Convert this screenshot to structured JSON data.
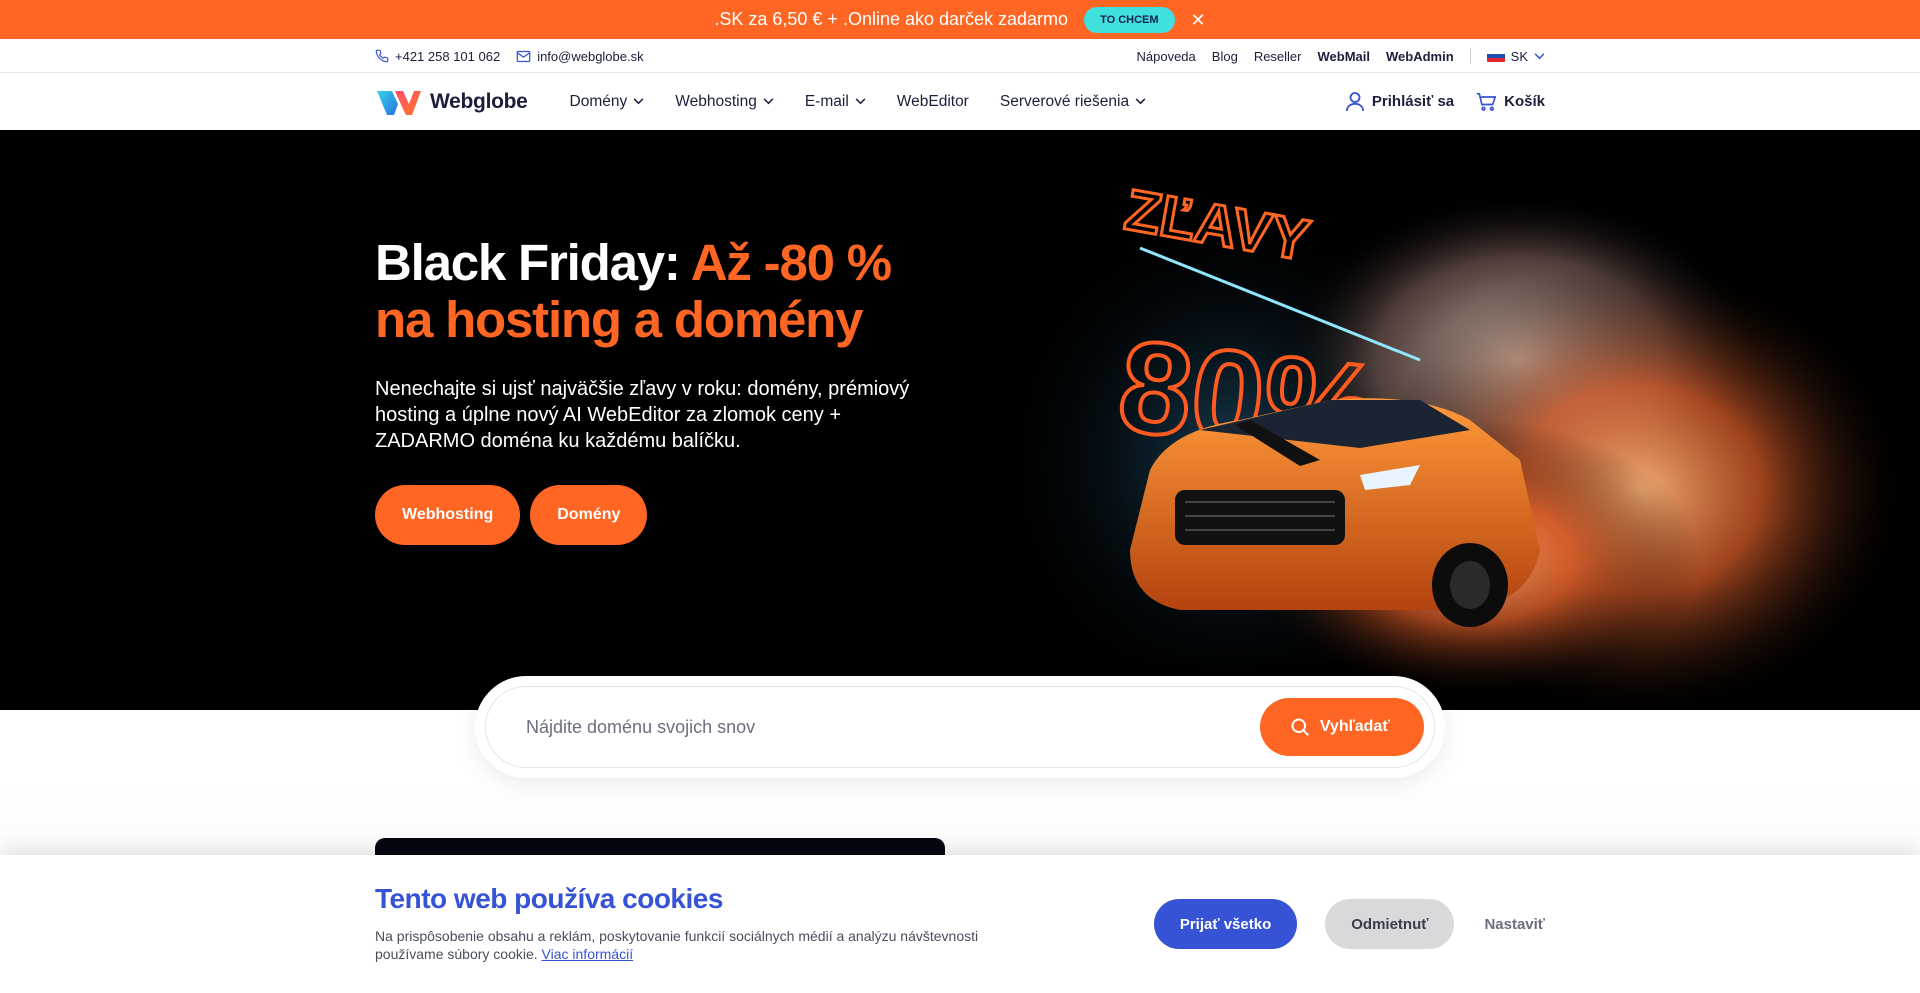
{
  "promo": {
    "text": ".SK za 6,50 € + .Online ako darček zadarmo",
    "button": "TO CHCEM",
    "close": "✕"
  },
  "topbar": {
    "phone": "+421 258 101 062",
    "email": "info@webglobe.sk",
    "links": [
      "Nápoveda",
      "Blog",
      "Reseller"
    ],
    "webmail": "WebMail",
    "webadmin": "WebAdmin",
    "lang": "SK"
  },
  "nav": {
    "logo": "Webglobe",
    "menu": [
      "Domény",
      "Webhosting",
      "E-mail",
      "WebEditor",
      "Serverové riešenia"
    ],
    "login": "Prihlásiť sa",
    "cart": "Košík"
  },
  "hero": {
    "title_white": "Black Friday: ",
    "title_orange_1": "Až -80 %",
    "title_orange_2": "na hosting a domény",
    "subtitle": "Nenechajte si ujsť najväčšie zľavy v roku: domény, prémiový hosting a úplne nový AI WebEditor za zlomok ceny + ZADARMO doména ku každému balíčku.",
    "btn_hosting": "Webhosting",
    "btn_domains": "Domény",
    "art_text_1": "ZĽAVY",
    "art_text_2": "80%"
  },
  "search": {
    "placeholder": "Nájdite doménu svojich snov",
    "button": "Vyhľadať"
  },
  "cookie": {
    "title": "Tento web používa cookies",
    "text": "Na prispôsobenie obsahu a reklám, poskytovanie funkcií sociálnych médií a analýzu návštevnosti používame súbory cookie.",
    "more": "Viac informácií",
    "accept": "Prijať všetko",
    "reject": "Odmietnuť",
    "settings": "Nastaviť"
  },
  "colors": {
    "brand_orange": "#ff6624",
    "brand_blue": "#3553d4",
    "promo_button": "#3fe0dd",
    "dark_text": "#1b1f3b"
  }
}
